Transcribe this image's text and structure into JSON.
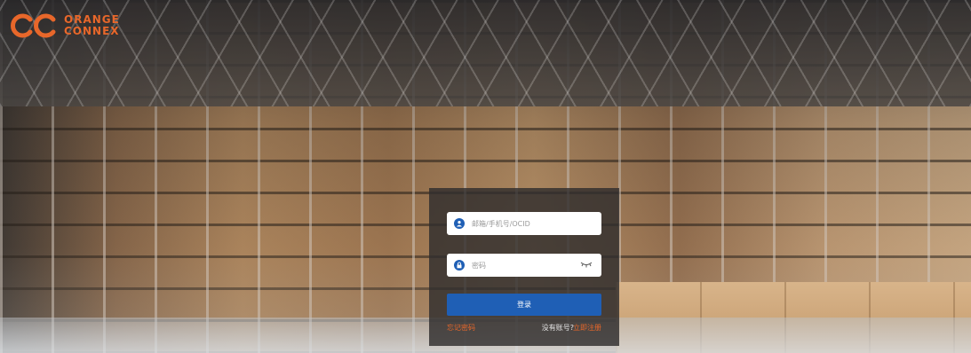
{
  "brand": {
    "line1": "ORANGE",
    "line2": "CONNEX",
    "color": "#e8672a",
    "icon": "oc-logo-icon"
  },
  "login": {
    "username_placeholder": "邮箱/手机号/OCID",
    "username_icon": "user-icon",
    "password_placeholder": "密码",
    "password_icon": "lock-icon",
    "visibility_icon": "eye-closed-icon",
    "submit_label": "登录",
    "forgot_label": "忘记密码",
    "no_account_label": "没有账号?",
    "register_label": "立即注册"
  },
  "colors": {
    "primary": "#1f5fb5",
    "accent": "#e8672a",
    "panel": "rgba(48,45,45,0.82)"
  }
}
